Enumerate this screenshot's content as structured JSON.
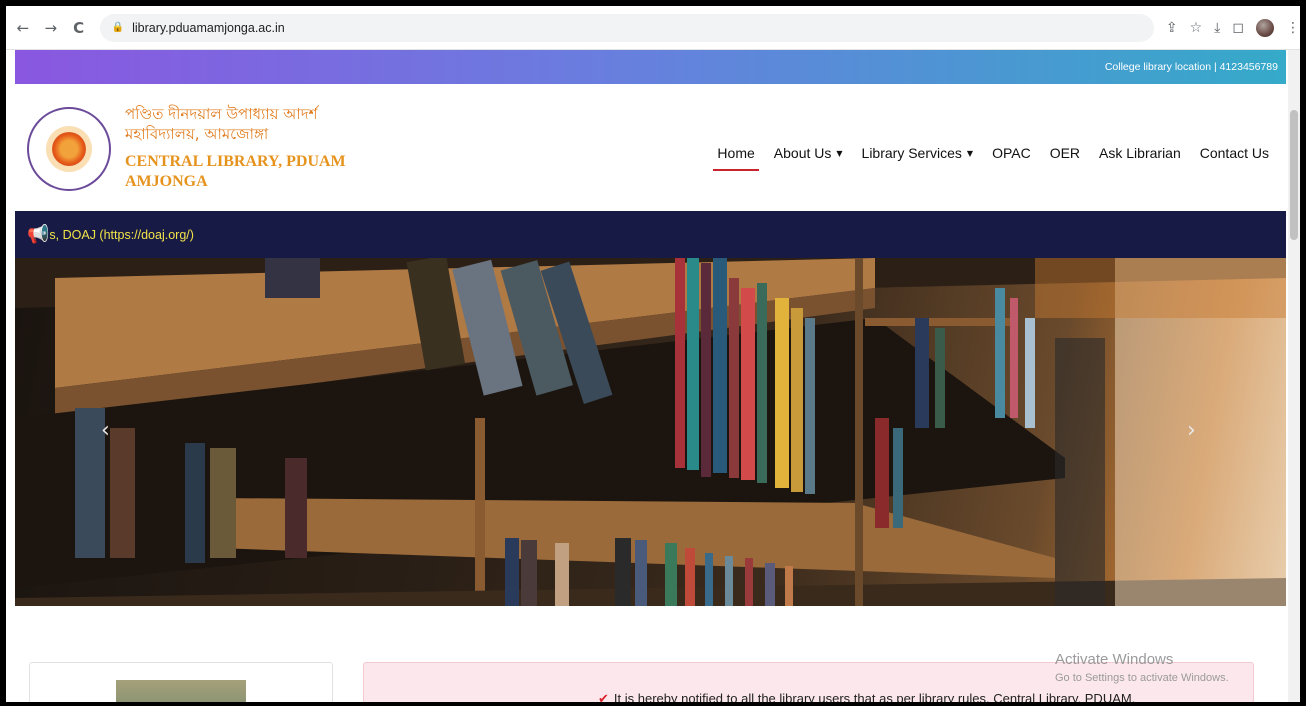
{
  "browser": {
    "url": "library.pduamamjonga.ac.in",
    "back_icon": "←",
    "forward_icon": "→",
    "reload_icon": "C",
    "lock_icon": "🔒",
    "share_icon": "⇪",
    "star_icon": "☆",
    "download_icon": "⤓",
    "split_icon": "◻",
    "menu_icon": "⋮"
  },
  "topbar": {
    "text": "College library location | 4123456789"
  },
  "header": {
    "title_bn_line1": "পণ্ডিত দীনদয়াল উপাধ্যায় আদর্শ",
    "title_bn_line2": "মহাবিদ্যালয়, আমজোঙ্গা",
    "title_en_line1": "CENTRAL LIBRARY, PDUAM",
    "title_en_line2": "AMJONGA"
  },
  "nav": {
    "home": "Home",
    "about": "About Us",
    "services": "Library Services",
    "opac": "OPAC",
    "oer": "OER",
    "ask": "Ask Librarian",
    "contact": "Contact Us",
    "caret": "▼"
  },
  "marquee": {
    "icon": "📢",
    "text": "s, DOAJ (https://doaj.org/)"
  },
  "hero": {
    "prev": "‹",
    "next": "›"
  },
  "notice": {
    "check": "✔",
    "text": "It is hereby notified to all the library users that as per library rules, Central Library, PDUAM,",
    "dots": "••• •••"
  },
  "watermark": {
    "line1": "Activate Windows",
    "line2": "Go to Settings to activate Windows."
  },
  "colors": {
    "accent_red": "#c8242b",
    "marquee_bg": "#171a44",
    "marquee_text": "#f2e34a",
    "brand_orange": "#e6931e"
  }
}
